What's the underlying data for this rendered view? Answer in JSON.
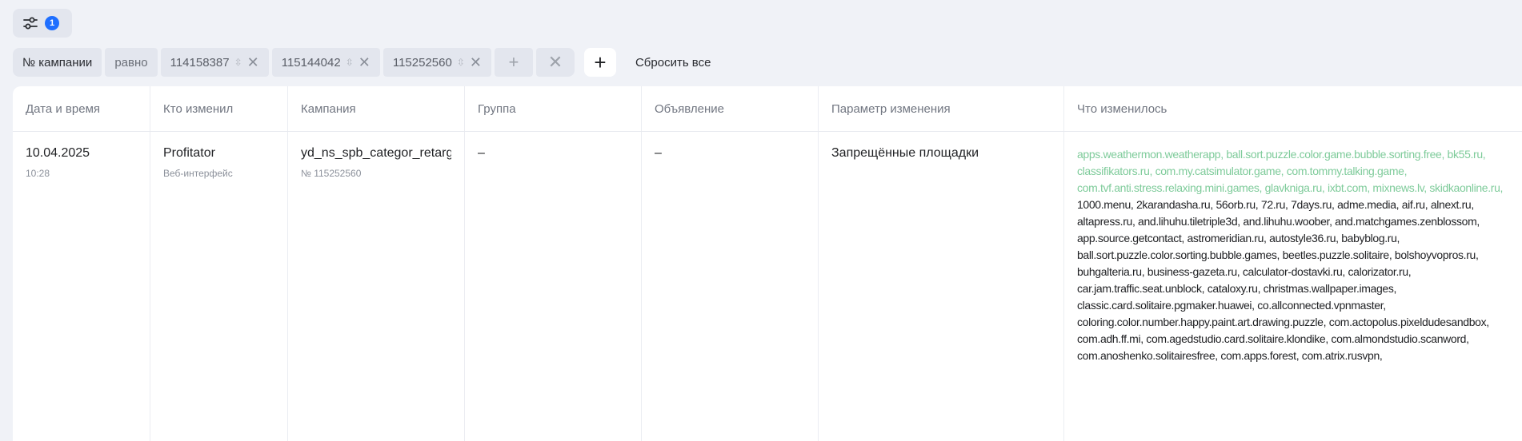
{
  "filter_bar": {
    "filter_count": "1"
  },
  "filter_chips": {
    "field": "№ кампании",
    "operator": "равно",
    "values": [
      "114158387",
      "115144042",
      "115252560"
    ],
    "reset_label": "Сбросить все"
  },
  "icons": {
    "filter": "sliders-icon",
    "remove": "close-icon",
    "add": "plus-icon",
    "stepper": "up-down-arrows-icon"
  },
  "colors": {
    "accent": "#1f6fff",
    "added_text": "#7ecb9a",
    "background": "#f0f2f7"
  },
  "table": {
    "headers": [
      "Дата и время",
      "Кто изменил",
      "Кампания",
      "Группа",
      "Объявление",
      "Параметр изменения",
      "Что изменилось"
    ],
    "rows": [
      {
        "date": "10.04.2025",
        "time": "10:28",
        "user": "Profitator",
        "user_source": "Веб-интерфейс",
        "campaign_name": "yd_ns_spb_categor_retarg",
        "campaign_id": "№ 115252560",
        "group": "–",
        "ad": "–",
        "parameter": "Запрещённые площадки",
        "added": "apps.weathermon.weatherapp, ball.sort.puzzle.color.game.bubble.sorting.free, bk55.ru, classifikators.ru, com.my.catsimulator.game, com.tommy.talking.game, com.tvf.anti.stress.relaxing.mini.games, glavkniga.ru, ixbt.com, mixnews.lv, skidkaonline.ru,",
        "existing": "1000.menu, 2karandasha.ru, 56orb.ru, 72.ru, 7days.ru, adme.media, aif.ru, alnext.ru, altapress.ru, and.lihuhu.tiletriple3d, and.lihuhu.woober, and.matchgames.zenblossom, app.source.getcontact, astromeridian.ru, autostyle36.ru, babyblog.ru, ball.sort.puzzle.color.sorting.bubble.games, beetles.puzzle.solitaire, bolshoyvopros.ru, buhgalteria.ru, business-gazeta.ru, calculator-dostavki.ru, calorizator.ru, car.jam.traffic.seat.unblock, cataloxy.ru, christmas.wallpaper.images, classic.card.solitaire.pgmaker.huawei, co.allconnected.vpnmaster, coloring.color.number.happy.paint.art.drawing.puzzle, com.actopolus.pixeldudesandbox, com.adh.ff.mi, com.agedstudio.card.solitaire.klondike, com.almondstudio.scanword, com.anoshenko.solitairesfree, com.apps.forest, com.atrix.rusvpn,"
      }
    ]
  }
}
